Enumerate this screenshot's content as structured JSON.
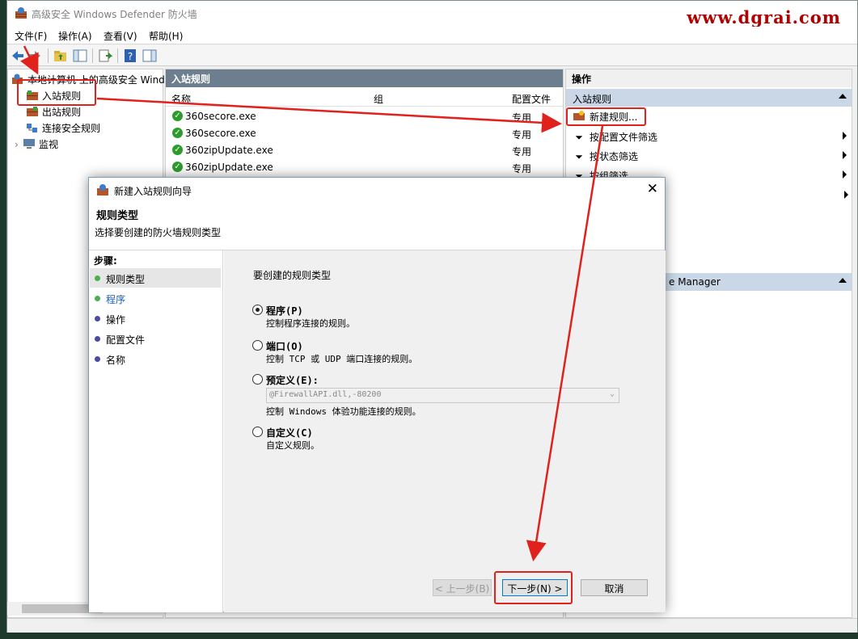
{
  "window": {
    "title": "高级安全 Windows Defender 防火墙"
  },
  "watermark": "www.dgrai.com",
  "menu": [
    "文件(F)",
    "操作(A)",
    "查看(V)",
    "帮助(H)"
  ],
  "tree": {
    "root": "本地计算机 上的高级安全 Wind",
    "items": [
      "入站规则",
      "出站规则",
      "连接安全规则",
      "监视"
    ]
  },
  "center": {
    "header": "入站规则",
    "columns": {
      "name": "名称",
      "group": "组",
      "profile": "配置文件"
    },
    "rows": [
      {
        "name": "360secore.exe",
        "profile": "专用"
      },
      {
        "name": "360secore.exe",
        "profile": "专用"
      },
      {
        "name": "360zipUpdate.exe",
        "profile": "专用"
      },
      {
        "name": "360zipUpdate.exe",
        "profile": "专用"
      }
    ]
  },
  "actions": {
    "header": "操作",
    "section": "入站规则",
    "items": [
      "新建规则...",
      "按配置文件筛选",
      "按状态筛选",
      "按组筛选"
    ],
    "partial_section": "e Manager"
  },
  "dialog": {
    "title": "新建入站规则向导",
    "heading": "规则类型",
    "subheading": "选择要创建的防火墙规则类型",
    "steps_label": "步骤:",
    "steps": [
      {
        "label": "规则类型",
        "color": "#4caf50"
      },
      {
        "label": "程序",
        "color": "#4caf50"
      },
      {
        "label": "操作",
        "color": "#4a4aa8"
      },
      {
        "label": "配置文件",
        "color": "#4a4aa8"
      },
      {
        "label": "名称",
        "color": "#4a4aa8"
      }
    ],
    "question": "要创建的规则类型",
    "options": [
      {
        "title": "程序(P)",
        "desc": "控制程序连接的规则。",
        "selected": true
      },
      {
        "title": "端口(O)",
        "desc": "控制 TCP 或 UDP 端口连接的规则。",
        "selected": false
      },
      {
        "title": "预定义(E):",
        "desc": "控制 Windows 体验功能连接的规则。",
        "selected": false
      },
      {
        "title": "自定义(C)",
        "desc": "自定义规则。",
        "selected": false
      }
    ],
    "predefined_value": "@FirewallAPI.dll,-80200",
    "buttons": {
      "back": "< 上一步(B)",
      "next": "下一步(N) >",
      "cancel": "取消"
    }
  },
  "colors": {
    "annotation": "#e0211c",
    "pane_header": "#6d7f8e",
    "action_header": "#c9d7e6"
  }
}
